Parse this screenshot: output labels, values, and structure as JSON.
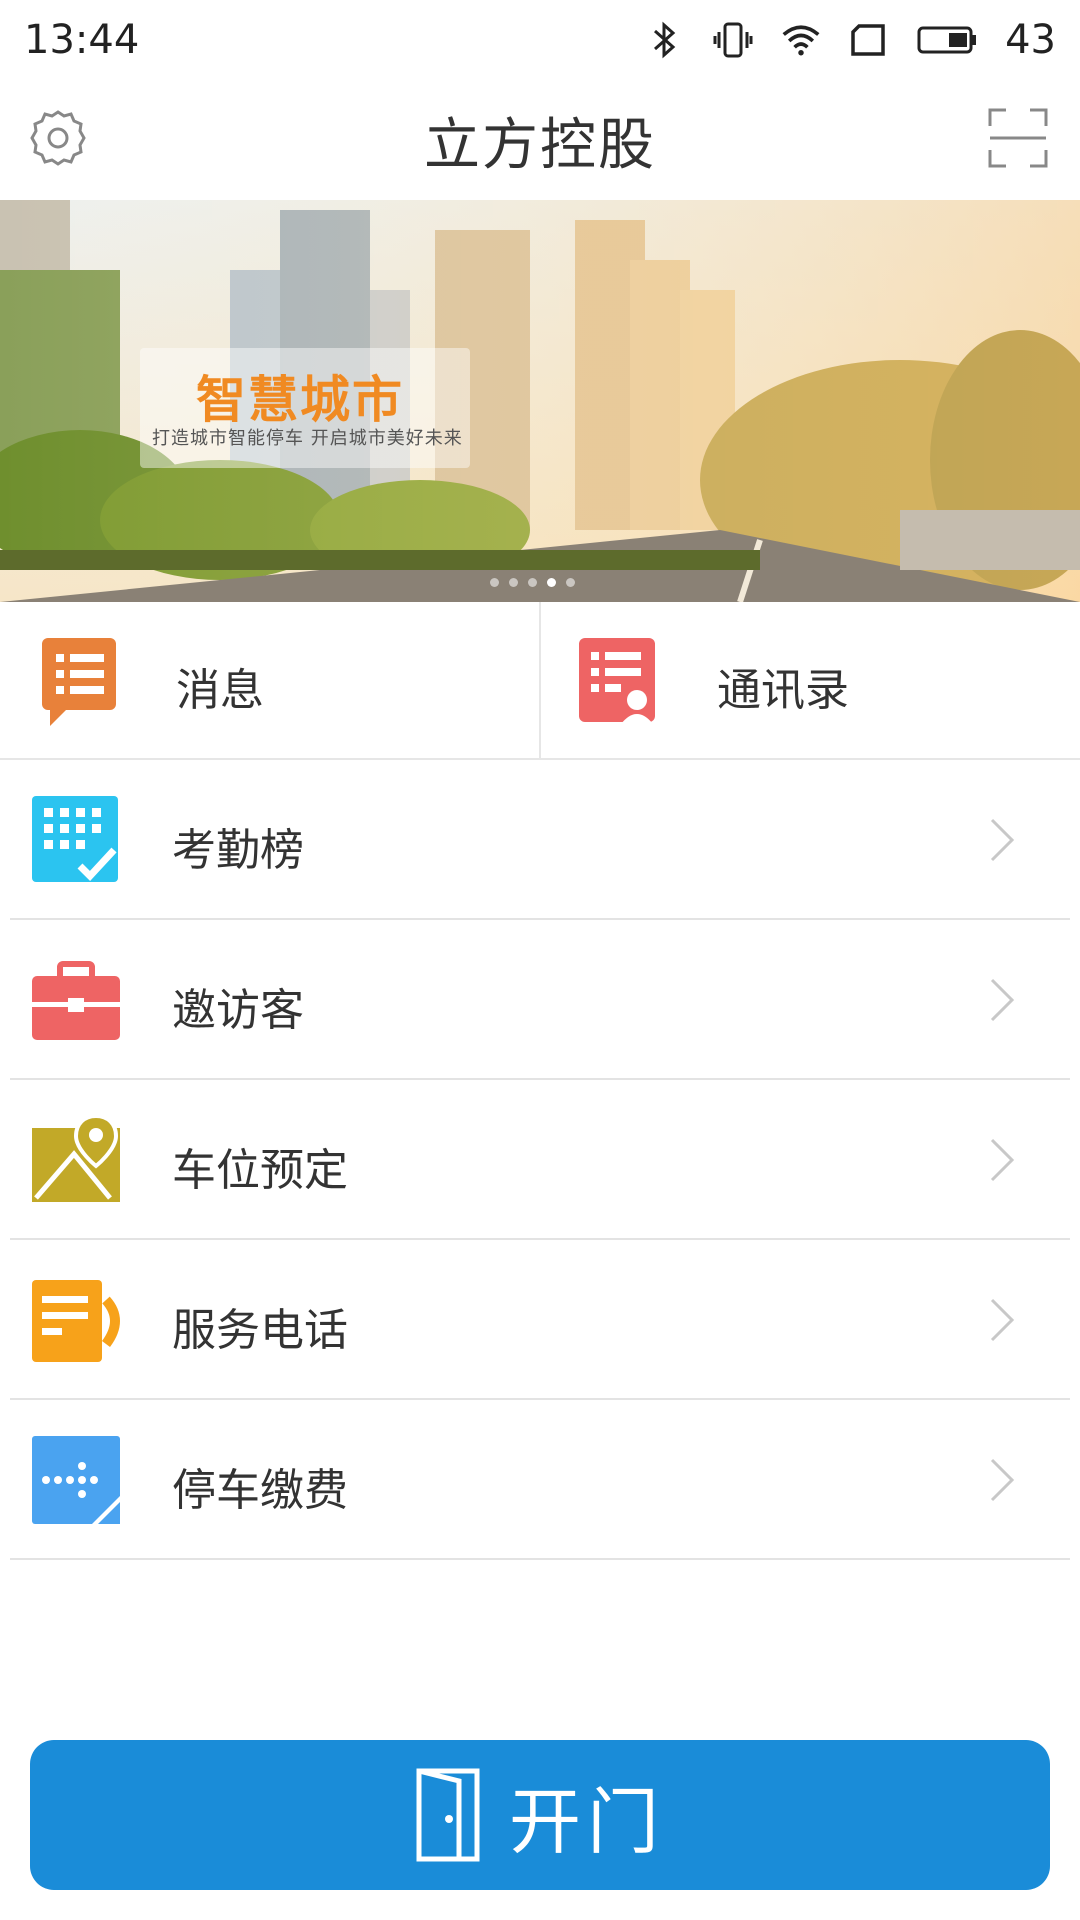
{
  "status_bar": {
    "time": "13:44",
    "battery_level": "43",
    "icons": [
      "bluetooth-icon",
      "vibrate-icon",
      "wifi-icon",
      "sim-icon",
      "battery-icon"
    ]
  },
  "header": {
    "title": "立方控股",
    "left_icon": "settings-icon",
    "right_icon": "scan-icon"
  },
  "banner": {
    "title": "智慧城市",
    "subtitle": "打造城市智能停车  开启城市美好未来",
    "page_count": 5,
    "active_page": 3
  },
  "quick_actions": [
    {
      "label": "消息",
      "icon": "message-icon",
      "color": "#e8813a"
    },
    {
      "label": "通讯录",
      "icon": "contacts-icon",
      "color": "#ee6464"
    }
  ],
  "menu": [
    {
      "label": "考勤榜",
      "icon": "attendance-icon",
      "color": "#2bc4f0"
    },
    {
      "label": "邀访客",
      "icon": "briefcase-icon",
      "color": "#ee6464"
    },
    {
      "label": "车位预定",
      "icon": "map-pin-icon",
      "color": "#c2a928"
    },
    {
      "label": "服务电话",
      "icon": "service-phone-icon",
      "color": "#f7a21a"
    },
    {
      "label": "停车缴费",
      "icon": "parking-pay-icon",
      "color": "#4aa3f0"
    }
  ],
  "open_button": {
    "label": "开门",
    "icon": "door-icon",
    "color": "#1a8cd8"
  }
}
